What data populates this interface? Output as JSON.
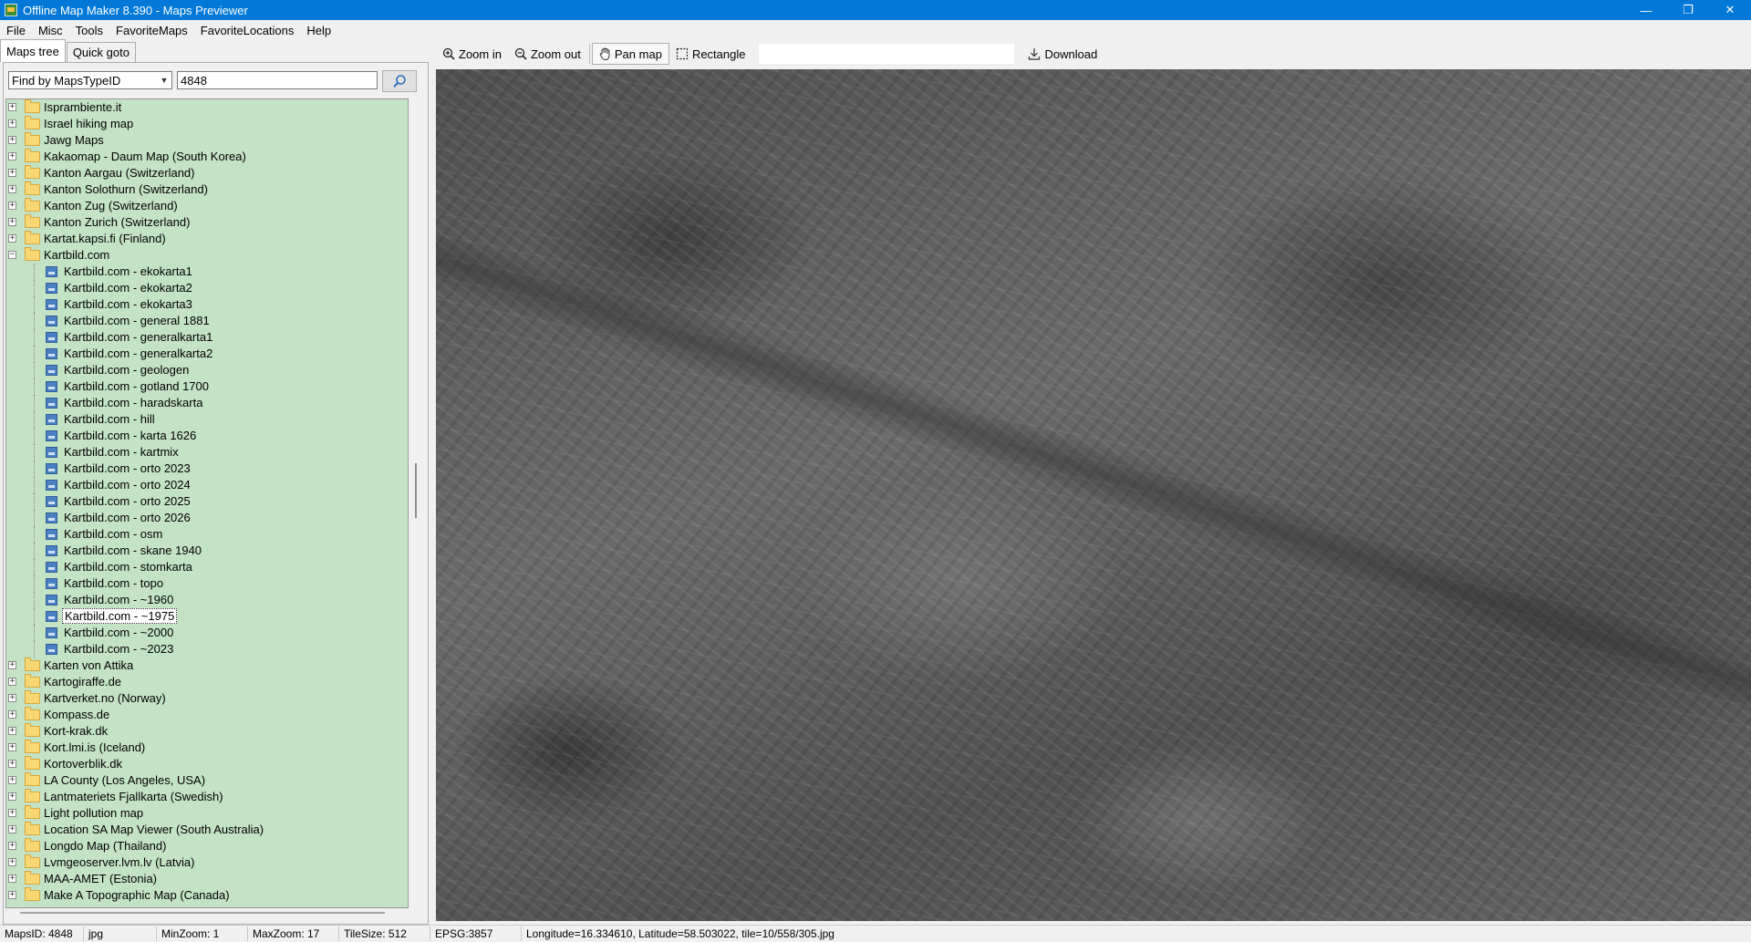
{
  "window": {
    "title": "Offline Map Maker 8.390 - Maps Previewer",
    "controls": [
      "—",
      "❐",
      "✕"
    ]
  },
  "menu": {
    "items": [
      "File",
      "Misc",
      "Tools",
      "FavoriteMaps",
      "FavoriteLocations",
      "Help"
    ]
  },
  "left_panel": {
    "tabs": [
      "Maps tree",
      "Quick goto"
    ],
    "find_mode": "Find by MapsTypeID",
    "search_value": "4848",
    "tree": {
      "folders_before": [
        "Isprambiente.it",
        "Israel hiking map",
        "Jawg Maps",
        "Kakaomap - Daum Map (South Korea)",
        "Kanton Aargau (Switzerland)",
        "Kanton Solothurn (Switzerland)",
        "Kanton Zug (Switzerland)",
        "Kanton Zurich (Switzerland)",
        "Kartat.kapsi.fi (Finland)"
      ],
      "expanded_folder": "Kartbild.com",
      "children": [
        "Kartbild.com - ekokarta1",
        "Kartbild.com - ekokarta2",
        "Kartbild.com - ekokarta3",
        "Kartbild.com - general 1881",
        "Kartbild.com - generalkarta1",
        "Kartbild.com - generalkarta2",
        "Kartbild.com - geologen",
        "Kartbild.com - gotland 1700",
        "Kartbild.com - haradskarta",
        "Kartbild.com - hill",
        "Kartbild.com - karta 1626",
        "Kartbild.com - kartmix",
        "Kartbild.com - orto 2023",
        "Kartbild.com - orto 2024",
        "Kartbild.com - orto 2025",
        "Kartbild.com - orto 2026",
        "Kartbild.com - osm",
        "Kartbild.com - skane 1940",
        "Kartbild.com - stomkarta",
        "Kartbild.com - topo",
        "Kartbild.com - ~1960",
        "Kartbild.com - ~1975",
        "Kartbild.com - ~2000",
        "Kartbild.com - ~2023"
      ],
      "selected_child": "Kartbild.com - ~1975",
      "folders_after": [
        "Karten von Attika",
        "Kartogiraffe.de",
        "Kartverket.no (Norway)",
        "Kompass.de",
        "Kort-krak.dk",
        "Kort.lmi.is (Iceland)",
        "Kortoverblik.dk",
        "LA County (Los Angeles, USA)",
        "Lantmateriets Fjallkarta (Swedish)",
        "Light pollution map",
        "Location SA Map Viewer (South Australia)",
        "Longdo Map (Thailand)",
        "Lvmgeoserver.lvm.lv (Latvia)",
        "MAA-AMET (Estonia)",
        "Make A Topographic Map (Canada)"
      ]
    }
  },
  "toolbar": {
    "zoom_in": "Zoom in",
    "zoom_out": "Zoom out",
    "pan_map": "Pan map",
    "rectangle": "Rectangle",
    "download": "Download"
  },
  "status": {
    "maps_id": "MapsID: 4848",
    "format": "jpg",
    "min_zoom": "MinZoom: 1",
    "max_zoom": "MaxZoom: 17",
    "tile_size": "TileSize: 512",
    "epsg": "EPSG:3857",
    "coords": "Longitude=16.334610, Latitude=58.503022, tile=10/558/305.jpg"
  },
  "colors": {
    "titlebar": "#0078d7",
    "tree_background": "#c4e2c4"
  }
}
